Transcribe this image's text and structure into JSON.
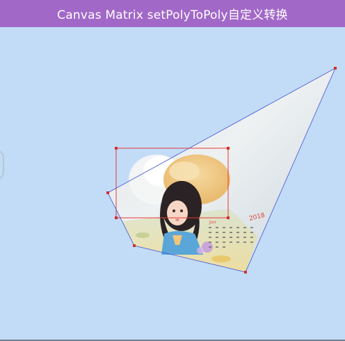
{
  "window": {
    "title": "Canvas Matrix setPolyToPoly自定义转换"
  },
  "calendar": {
    "year": "2018",
    "month_label": "Jun"
  },
  "colors": {
    "title_bar": "#a268c8",
    "canvas_bg": "#c2dcf7",
    "outline_line": "#3f4fd6",
    "source_rect": "#e53935",
    "control_point": "#d32f2f"
  }
}
